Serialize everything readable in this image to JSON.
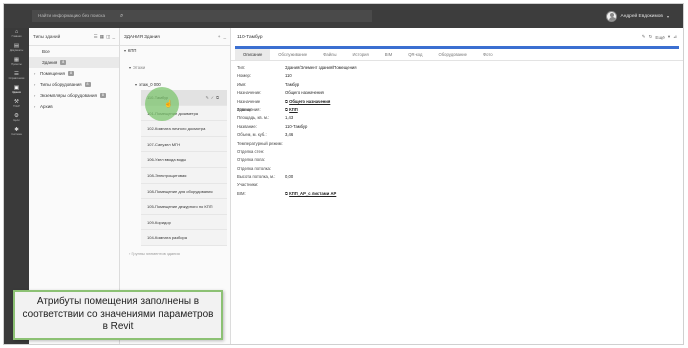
{
  "topbar": {
    "search_placeholder": "Найти информацию без поиска",
    "user_name": "Андрей Евдокимов"
  },
  "rail": {
    "items": [
      {
        "icon": "home-icon",
        "label": "Главная"
      },
      {
        "icon": "documents-icon",
        "label": "Документы"
      },
      {
        "icon": "projects-icon",
        "label": "Проекты"
      },
      {
        "icon": "catalogs-icon",
        "label": "Справочники"
      },
      {
        "icon": "buildings-icon",
        "label": "Здания"
      },
      {
        "icon": "tasks-icon",
        "label": "ТОиР"
      },
      {
        "icon": "settings-icon",
        "label": "Цели"
      },
      {
        "icon": "system-icon",
        "label": "Система"
      }
    ]
  },
  "panel1": {
    "title": "Типы зданий",
    "items": [
      {
        "label": "Все",
        "badge": ""
      },
      {
        "label": "Здания",
        "badge": "8"
      }
    ],
    "tree": [
      {
        "label": "Помещения",
        "badge": "8"
      },
      {
        "label": "Типы оборудования",
        "badge": "8"
      },
      {
        "label": "Экземпляры оборудования",
        "badge": "8"
      },
      {
        "label": "Архив",
        "badge": ""
      }
    ]
  },
  "panel2": {
    "title": "ЗДАНИЯ Здания",
    "root": "КПП",
    "floors_label": "Этажи",
    "floor": "этаж_0 000",
    "rooms": [
      "110-Тамбур",
      "101-Помещение дозиметра",
      "102-Комната личного досмотра",
      "107-Санузел МГН",
      "106-Узел ввода воды",
      "108-Электрощитовая",
      "108-Помещение для оборудования",
      "105-Помещение дежурного по КПП",
      "109-Коридор",
      "104-Комната разбора"
    ],
    "footer": "Группы элементов здания"
  },
  "panel3": {
    "title": "110-Тамбур",
    "action": "Ещё",
    "tabs": [
      "Описание",
      "Обслуживание",
      "Файлы",
      "История",
      "BIM",
      "QR-код",
      "Оборудование",
      "Фото"
    ],
    "properties": [
      {
        "key": "Тип:",
        "value": "Здания/Элемент здания/Помещения",
        "link": false
      },
      {
        "key": "Номер:",
        "value": "110",
        "link": false
      },
      {
        "key": "Имя:",
        "value": "Тамбур",
        "link": false
      },
      {
        "key": "Назначение:",
        "value": "Общего назначения",
        "link": false
      },
      {
        "key": "Назначение помещения:",
        "value": "Общего назначения",
        "link": true
      },
      {
        "key": "Здание:",
        "value": "КПП",
        "link": true
      },
      {
        "key": "Площадь, кв. м.:",
        "value": "1,43",
        "link": false
      },
      {
        "key": "Название:",
        "value": "110-Тамбур",
        "link": false
      },
      {
        "key": "Объем, м. куб.:",
        "value": "3,46",
        "link": false
      },
      {
        "key": "Температурный режим:",
        "value": "",
        "link": false
      },
      {
        "key": "Отделка стен:",
        "value": "",
        "link": false
      },
      {
        "key": "Отделка пола:",
        "value": "",
        "link": false
      },
      {
        "key": "Отделка потолка:",
        "value": "",
        "link": false
      },
      {
        "key": "Высота потолка, м.:",
        "value": "0,00",
        "link": false
      },
      {
        "key": "Участники:",
        "value": "",
        "link": false
      },
      {
        "key": "BIM:",
        "value": "КПП_АР_с листами АР",
        "link": true
      }
    ]
  },
  "callout": {
    "text": "Атрибуты помещения заполнены в соответствии со значениями параметров в Revit"
  },
  "colors": {
    "accent": "#3b6fd1",
    "highlight": "#78c46a",
    "topbar": "#3d3d3d"
  }
}
